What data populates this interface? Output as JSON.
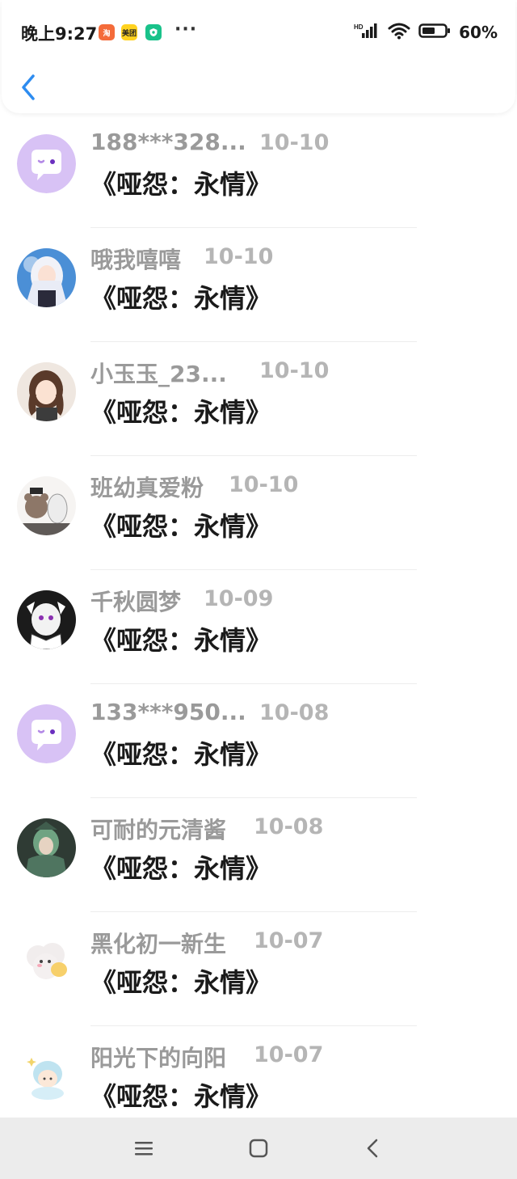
{
  "status_bar": {
    "time": "晚上9:27",
    "app_icons": [
      {
        "name": "taobao-icon",
        "label": "淘",
        "color": "#f46b3a"
      },
      {
        "name": "meituan-icon",
        "label": "美团",
        "color": "#ffd21f"
      },
      {
        "name": "shield-app-icon",
        "label": "",
        "color": "#19c28a"
      }
    ],
    "more": "···",
    "network": "HD",
    "battery": "60%"
  },
  "header": {
    "back_icon": "chevron-left-icon"
  },
  "list": [
    {
      "username": "188***328...",
      "date": "10-10",
      "comment": "《哑怨：永情》",
      "avatar": "default-chat-avatar"
    },
    {
      "username": "哦我嘻嘻",
      "date": "10-10",
      "comment": "《哑怨：永情》",
      "avatar": "anime-girl-white-hair-avatar"
    },
    {
      "username": "小玉玉_23...",
      "date": "10-10",
      "comment": "《哑怨：永情》",
      "avatar": "anime-girl-brown-hair-avatar"
    },
    {
      "username": "班幼真爱粉",
      "date": "10-10",
      "comment": "《哑怨：永情》",
      "avatar": "bear-cartoon-avatar"
    },
    {
      "username": "千秋圆梦",
      "date": "10-09",
      "comment": "《哑怨：永情》",
      "avatar": "manga-girl-avatar"
    },
    {
      "username": "133***950...",
      "date": "10-08",
      "comment": "《哑怨：永情》",
      "avatar": "default-chat-avatar"
    },
    {
      "username": "可耐的元清酱",
      "date": "10-08",
      "comment": "《哑怨：永情》",
      "avatar": "green-character-avatar"
    },
    {
      "username": "黑化初一新生",
      "date": "10-07",
      "comment": "《哑怨：永情》",
      "avatar": "cute-cloud-avatar"
    },
    {
      "username": "阳光下的向阳",
      "date": "10-07",
      "comment": "《哑怨：永情》",
      "avatar": "chibi-character-avatar"
    }
  ],
  "nav_bar": {
    "menu_icon": "menu-icon",
    "home_icon": "home-icon",
    "back_icon": "back-icon"
  },
  "colors": {
    "accent": "#2d8cf0",
    "default_avatar_bg": "#d8c2f5",
    "username": "#9a9a9a",
    "date": "#b5b5b5",
    "comment": "#1a1a1a"
  }
}
